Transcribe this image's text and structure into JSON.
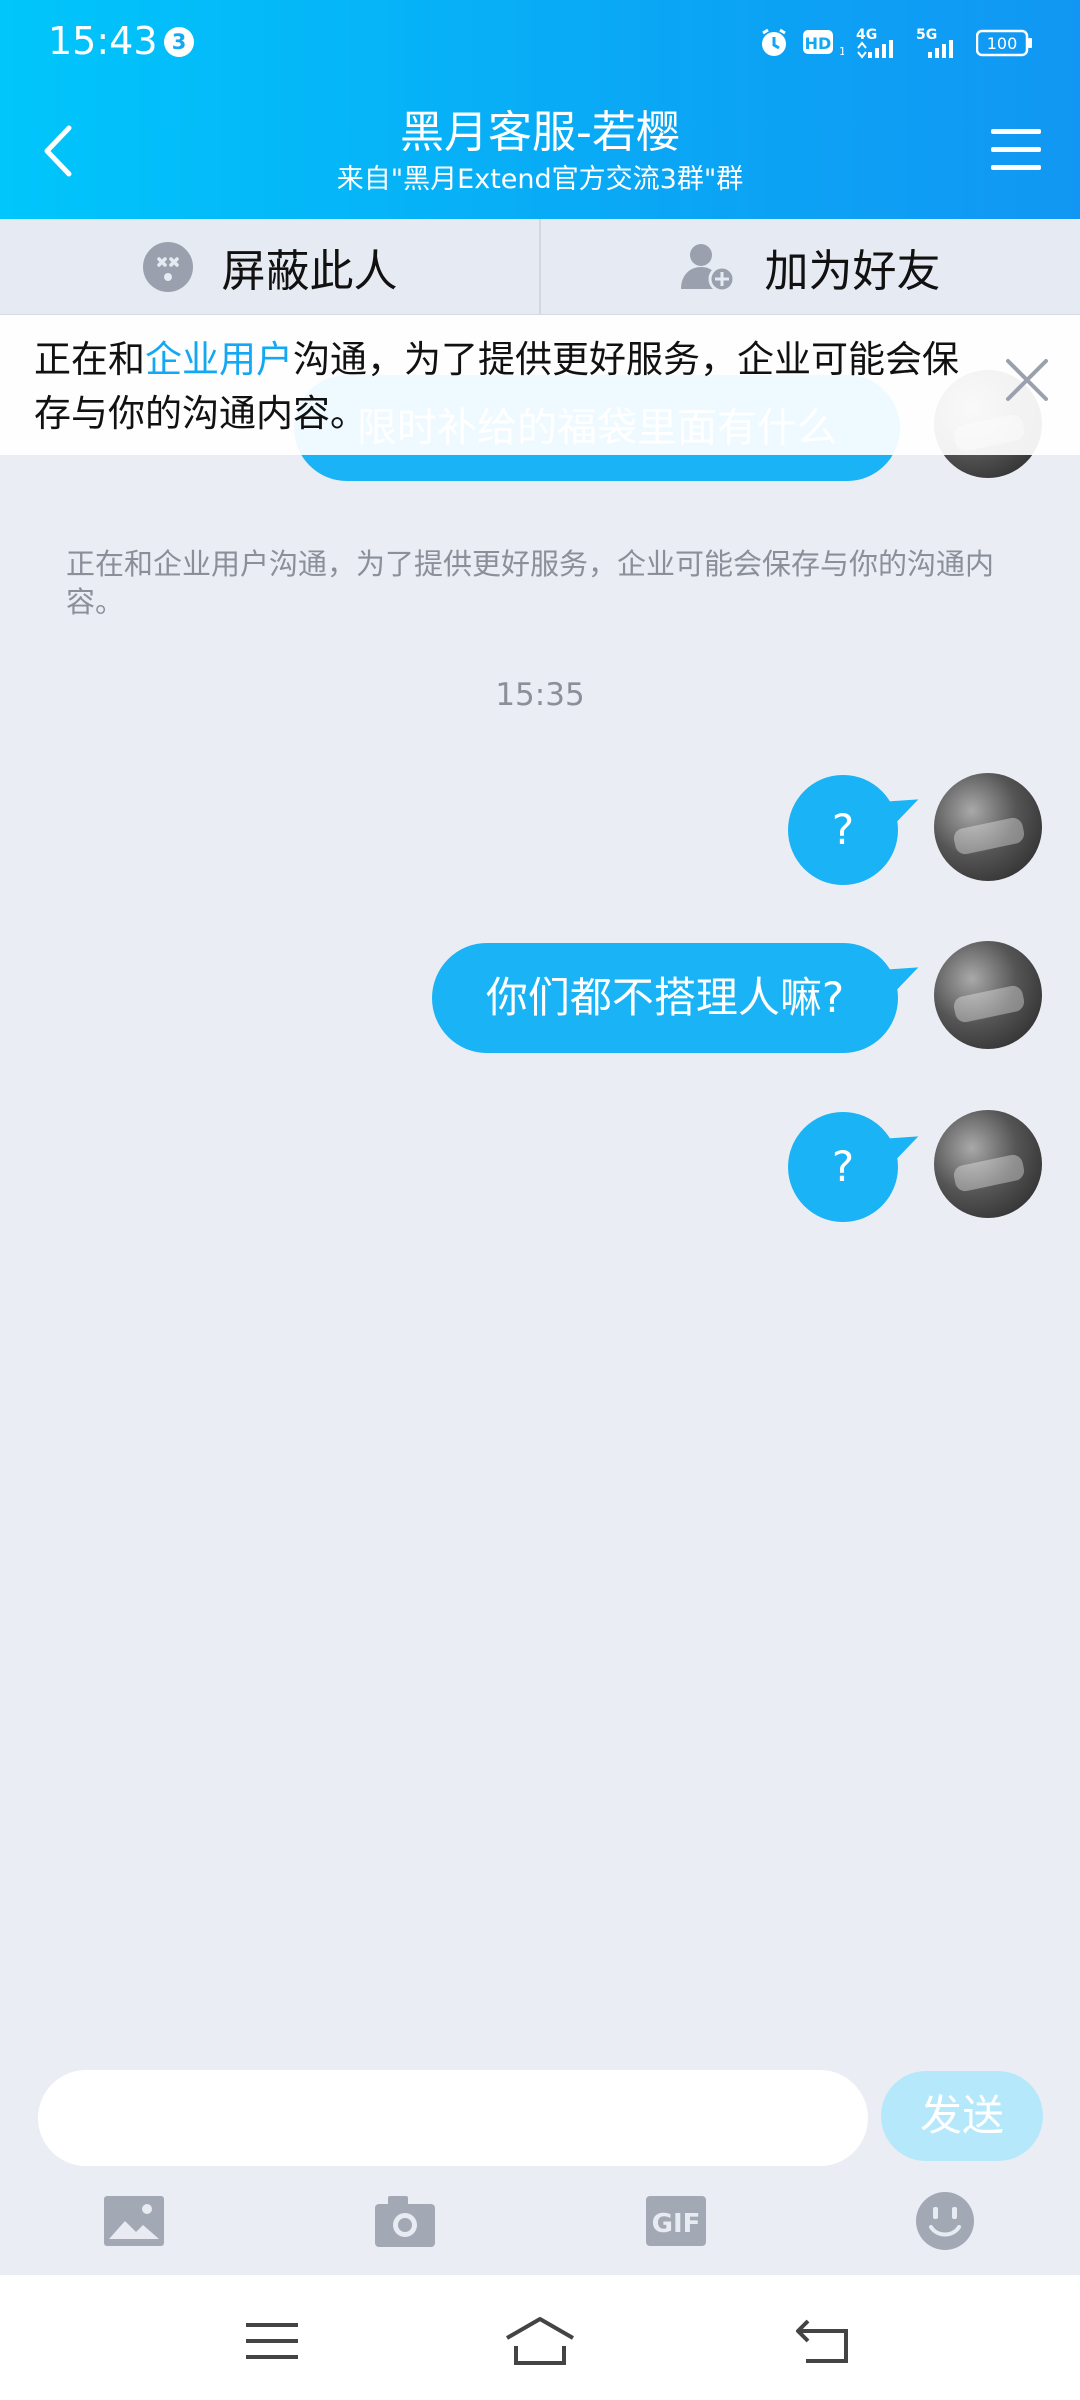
{
  "status_bar": {
    "time": "15:43",
    "notification_count": "3",
    "hd_label": "HD",
    "net1_label": "4G",
    "net2_label": "5G",
    "battery": "100"
  },
  "header": {
    "title": "黑月客服-若樱",
    "subtitle": "来自\"黑月Extend官方交流3群\"群"
  },
  "actions": {
    "block_label": "屏蔽此人",
    "add_friend_label": "加为好友"
  },
  "notice": {
    "prefix": "正在和",
    "highlight": "企业用户",
    "suffix": "沟通，为了提供更好服务，企业可能会保存与你的沟通内容。"
  },
  "chat": {
    "partial_message": "限时补给的福袋里面有什么",
    "system_note": "正在和企业用户沟通，为了提供更好服务，企业可能会保存与你的沟通内容。",
    "timestamp": "15:35",
    "messages": [
      {
        "text": "?"
      },
      {
        "text": "你们都不搭理人嘛?"
      },
      {
        "text": "?"
      }
    ]
  },
  "input": {
    "value": "",
    "placeholder": "",
    "send_label": "发送"
  },
  "colors": {
    "header_start": "#00c6fb",
    "header_end": "#1197f3",
    "bubble": "#1ab3f5",
    "background": "#eaedf4",
    "send_disabled": "#b6e8fb"
  }
}
